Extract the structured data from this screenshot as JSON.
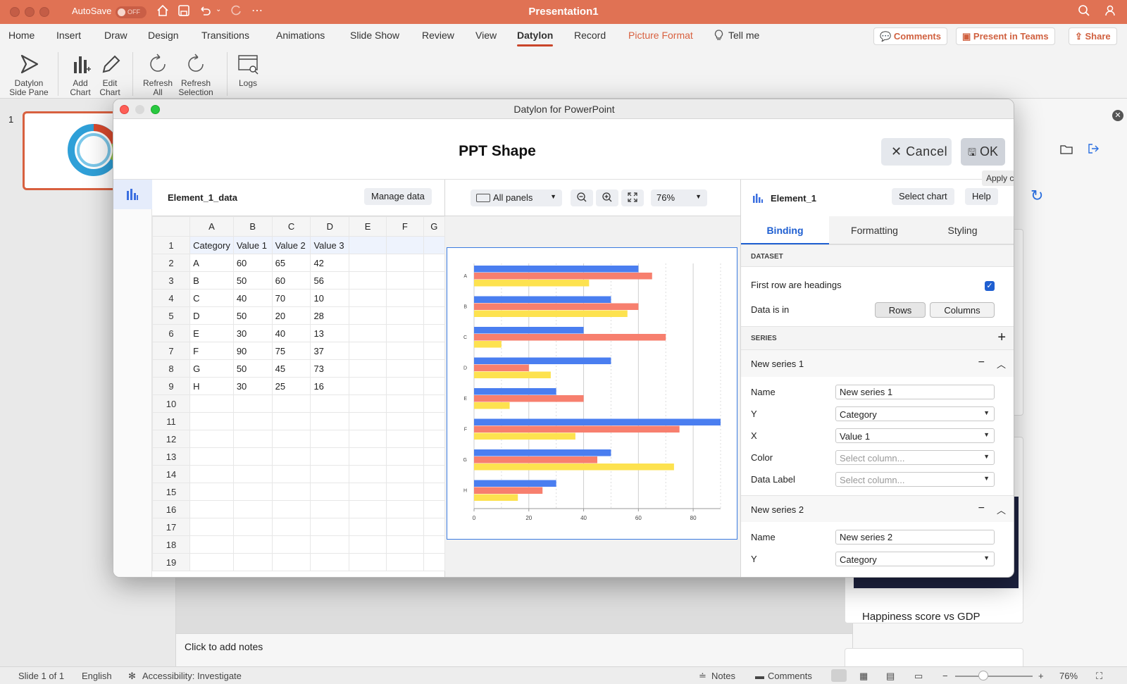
{
  "app": {
    "title": "Presentation1",
    "autosave_label": "AutoSave",
    "autosave_state": "OFF"
  },
  "ribbon": {
    "tabs": [
      "Home",
      "Insert",
      "Draw",
      "Design",
      "Transitions",
      "Animations",
      "Slide Show",
      "Review",
      "View",
      "Datylon",
      "Record",
      "Picture Format",
      "Tell me"
    ],
    "active_tab": "Datylon",
    "comments_label": "Comments",
    "present_label": "Present in Teams",
    "share_label": "Share",
    "commands": {
      "side_pane": "Datylon Side Pane",
      "add_chart": "Add Chart",
      "edit_chart": "Edit Chart",
      "refresh_all": "Refresh All",
      "refresh_selection": "Refresh Selection",
      "logs": "Logs"
    }
  },
  "thumbs": {
    "slide_number": "1"
  },
  "notes": {
    "placeholder": "Click to add notes"
  },
  "sidepane": {
    "card_title": "Happiness score vs GDP"
  },
  "status": {
    "slide": "Slide 1 of 1",
    "language": "English",
    "accessibility": "Accessibility: Investigate",
    "notes": "Notes",
    "comments": "Comments",
    "zoom": "76%"
  },
  "dialog": {
    "window_title": "Datylon for PowerPoint",
    "heading": "PPT Shape",
    "cancel_label": "Cancel",
    "ok_label": "OK",
    "tooltip": "Apply changes",
    "data_panel": {
      "title": "Element_1_data",
      "manage_label": "Manage data",
      "columns": [
        "A",
        "B",
        "C",
        "D",
        "E",
        "F",
        "G"
      ],
      "rows": [
        [
          "Category",
          "Value 1",
          "Value 2",
          "Value 3",
          "",
          "",
          ""
        ],
        [
          "A",
          "60",
          "65",
          "42",
          "",
          "",
          ""
        ],
        [
          "B",
          "50",
          "60",
          "56",
          "",
          "",
          ""
        ],
        [
          "C",
          "40",
          "70",
          "10",
          "",
          "",
          ""
        ],
        [
          "D",
          "50",
          "20",
          "28",
          "",
          "",
          ""
        ],
        [
          "E",
          "30",
          "40",
          "13",
          "",
          "",
          ""
        ],
        [
          "F",
          "90",
          "75",
          "37",
          "",
          "",
          ""
        ],
        [
          "G",
          "50",
          "45",
          "73",
          "",
          "",
          ""
        ],
        [
          "H",
          "30",
          "25",
          "16",
          "",
          "",
          ""
        ],
        [
          "",
          "",
          "",
          "",
          "",
          "",
          ""
        ],
        [
          "",
          "",
          "",
          "",
          "",
          "",
          ""
        ],
        [
          "",
          "",
          "",
          "",
          "",
          "",
          ""
        ],
        [
          "",
          "",
          "",
          "",
          "",
          "",
          ""
        ],
        [
          "",
          "",
          "",
          "",
          "",
          "",
          ""
        ],
        [
          "",
          "",
          "",
          "",
          "",
          "",
          ""
        ],
        [
          "",
          "",
          "",
          "",
          "",
          "",
          ""
        ],
        [
          "",
          "",
          "",
          "",
          "",
          "",
          ""
        ],
        [
          "",
          "",
          "",
          "",
          "",
          "",
          ""
        ],
        [
          "",
          "",
          "",
          "",
          "",
          "",
          ""
        ]
      ]
    },
    "chart_panel": {
      "panels_label": "All panels",
      "zoom": "76%"
    },
    "binding_panel": {
      "element_name": "Element_1",
      "select_chart_label": "Select chart",
      "help_label": "Help",
      "tabs": [
        "Binding",
        "Formatting",
        "Styling"
      ],
      "active_tab": "Binding",
      "dataset_header": "DATASET",
      "first_row_label": "First row are headings",
      "first_row_checked": true,
      "data_is_in_label": "Data is in",
      "rows_label": "Rows",
      "columns_label": "Columns",
      "series_header": "SERIES",
      "series": [
        {
          "title": "New series 1",
          "name_label": "Name",
          "name_value": "New series 1",
          "y_label": "Y",
          "y_value": "Category",
          "x_label": "X",
          "x_value": "Value 1",
          "color_label": "Color",
          "color_placeholder": "Select column...",
          "data_label_label": "Data Label",
          "data_label_placeholder": "Select column..."
        },
        {
          "title": "New series 2",
          "name_label": "Name",
          "name_value": "New series 2",
          "y_label": "Y",
          "y_value": "Category"
        }
      ]
    }
  },
  "colors": {
    "accent": "#e07254",
    "series": [
      "#4a7ef0",
      "#f77f6e",
      "#fde24f"
    ],
    "selection_blue": "#1f5fd1"
  },
  "chart_data": {
    "type": "bar",
    "orientation": "horizontal",
    "categories": [
      "A",
      "B",
      "C",
      "D",
      "E",
      "F",
      "G",
      "H"
    ],
    "series": [
      {
        "values": [
          60,
          50,
          40,
          50,
          30,
          90,
          50,
          30
        ]
      },
      {
        "values": [
          65,
          60,
          70,
          20,
          40,
          75,
          45,
          25
        ]
      },
      {
        "values": [
          42,
          56,
          10,
          28,
          13,
          37,
          73,
          16
        ]
      }
    ],
    "x_ticks": [
      0,
      20,
      40,
      60,
      80
    ],
    "xlim": [
      0,
      90
    ],
    "grid": true
  }
}
